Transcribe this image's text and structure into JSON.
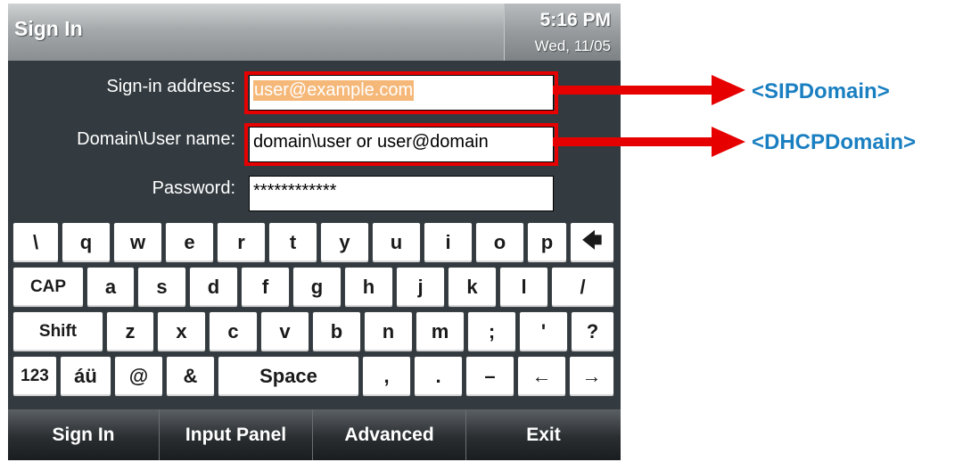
{
  "title_bar": {
    "title": "Sign In",
    "time": "5:16 PM",
    "date": "Wed, 11/05"
  },
  "form": {
    "sign_in_address": {
      "label": "Sign-in address:",
      "value": "user@example.com"
    },
    "domain_user": {
      "label": "Domain\\User name:",
      "value": "domain\\user or user@domain"
    },
    "password": {
      "label": "Password:",
      "value": "************"
    }
  },
  "keyboard": {
    "row1": [
      "\\",
      "q",
      "w",
      "e",
      "r",
      "t",
      "y",
      "u",
      "i",
      "o",
      "p",
      "🡄"
    ],
    "row2": [
      "CAP",
      "a",
      "s",
      "d",
      "f",
      "g",
      "h",
      "j",
      "k",
      "l",
      "/"
    ],
    "row3": [
      "Shift",
      "z",
      "x",
      "c",
      "v",
      "b",
      "n",
      "m",
      ";",
      "'",
      "?"
    ],
    "row4": [
      "123",
      "áü",
      "@",
      "&",
      "Space",
      ",",
      ".",
      "–",
      "←",
      "→"
    ]
  },
  "softkeys": [
    "Sign In",
    "Input Panel",
    "Advanced",
    "Exit"
  ],
  "callouts": {
    "sip": "<SIPDomain>",
    "dhcp": "<DHCPDomain>"
  },
  "colors": {
    "highlight": "#e60000",
    "callout_text": "#1a7fc1",
    "screen_bg": "#333b40"
  }
}
